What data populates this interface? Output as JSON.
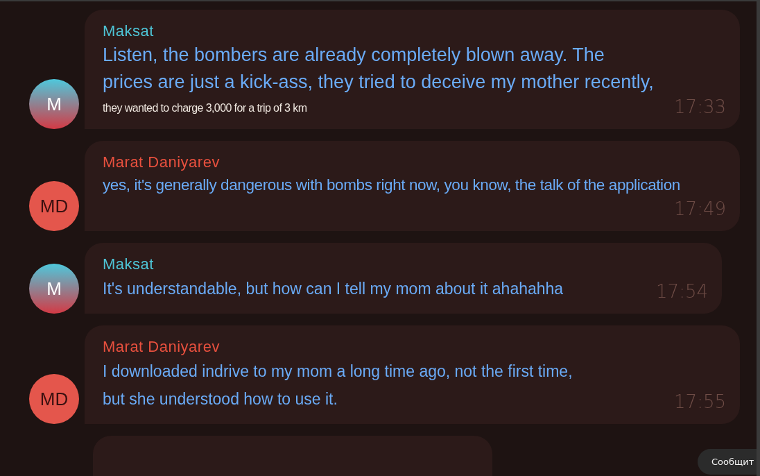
{
  "messages": [
    {
      "sender": "Maksat",
      "color": "#4ec4d6",
      "avatar": {
        "initials": "M",
        "kind": "gradient"
      },
      "lines": [
        {
          "text": "Listen, the bombers are already completely blown away. The",
          "kind": "large"
        },
        {
          "text": "prices are just a kick-ass, they tried to deceive my mother recently,",
          "kind": "large"
        },
        {
          "text": "they wanted to charge 3,000 for a trip of 3 km",
          "kind": "small"
        }
      ],
      "time": "17:33"
    },
    {
      "sender": "Marat Daniyarev",
      "color": "#e8503e",
      "avatar": {
        "initials": "MD",
        "kind": "solid"
      },
      "lines": [
        {
          "text": "yes, it's generally dangerous with bombs right now, you know, the talk of the application",
          "kind": "condensed"
        }
      ],
      "time": "17:49"
    },
    {
      "sender": "Maksat",
      "color": "#4ec4d6",
      "avatar": {
        "initials": "M",
        "kind": "gradient"
      },
      "lines": [
        {
          "text": "It's understandable, but how can I tell my mom about it ahahahha",
          "kind": "medium"
        }
      ],
      "time": "17:54"
    },
    {
      "sender": "Marat Daniyarev",
      "color": "#e8503e",
      "avatar": {
        "initials": "MD",
        "kind": "solid"
      },
      "lines": [
        {
          "text": "I downloaded indrive to my mom a long time ago, not the first time,",
          "kind": "medium"
        },
        {
          "text": "but she understood how to use it.",
          "kind": "medium"
        }
      ],
      "time": "17:55"
    }
  ],
  "tooltip": "Сообщит"
}
